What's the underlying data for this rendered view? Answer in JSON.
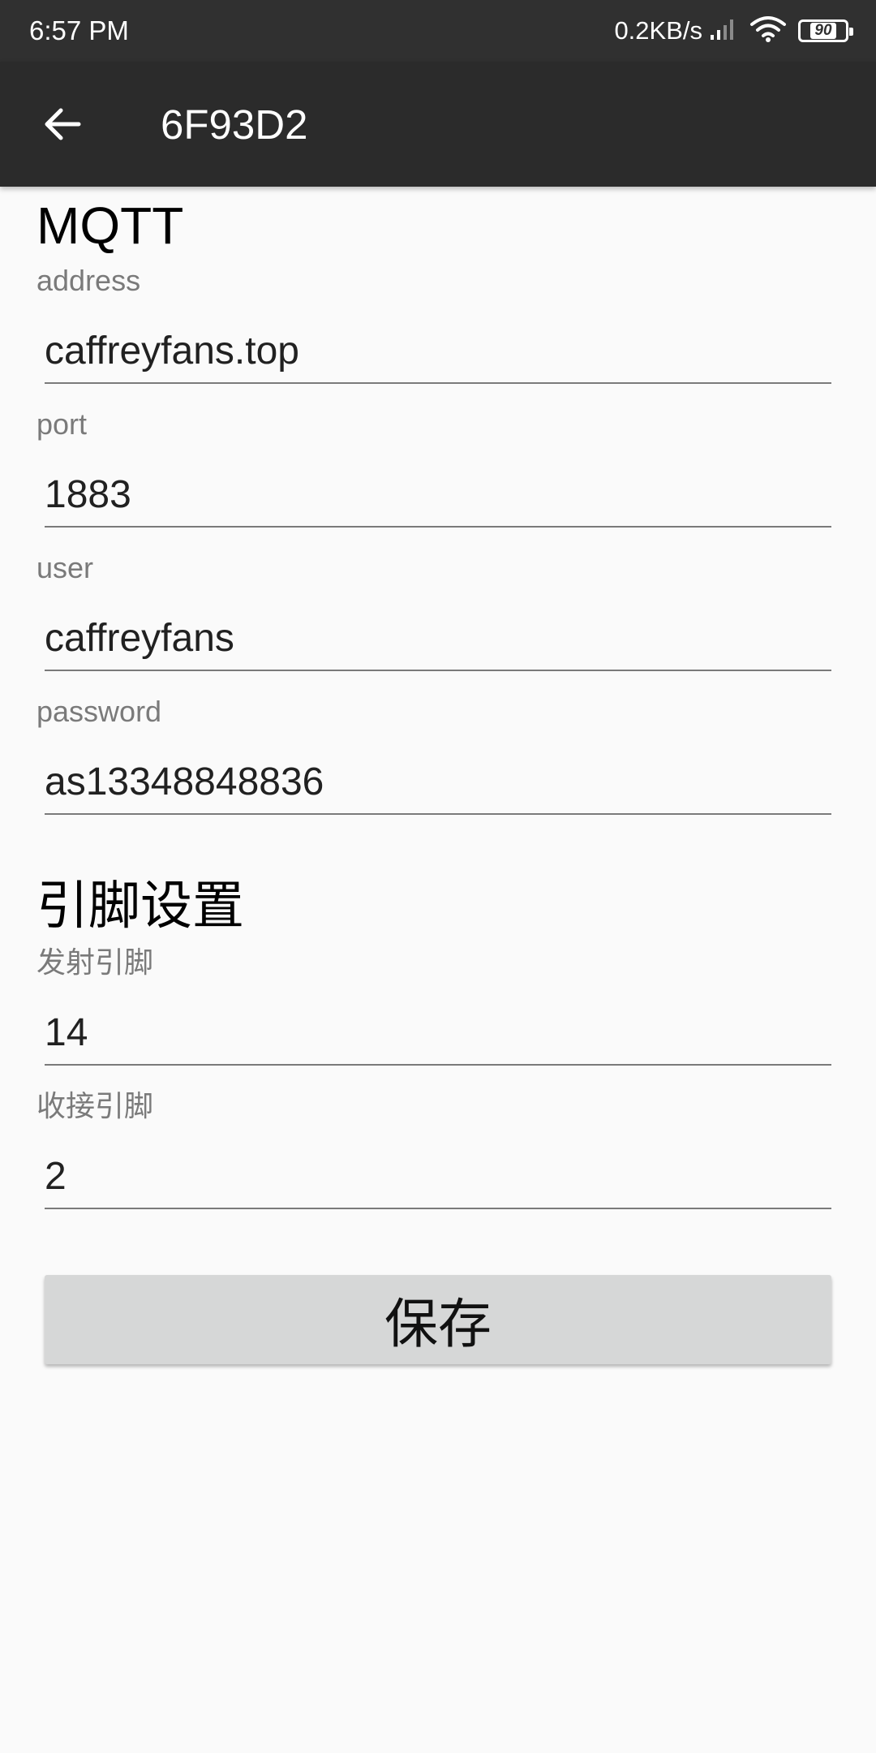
{
  "status_bar": {
    "time": "6:57 PM",
    "net_speed": "0.2KB/s",
    "battery": "90",
    "icons": [
      "signal-icon",
      "wifi-icon",
      "battery-icon"
    ]
  },
  "app_bar": {
    "title": "6F93D2",
    "back_icon": "arrow-back-icon"
  },
  "mqtt": {
    "title": "MQTT",
    "address_label": "address",
    "address_value": "caffreyfans.top",
    "port_label": "port",
    "port_value": "1883",
    "user_label": "user",
    "user_value": "caffreyfans",
    "password_label": "password",
    "password_value": "as13348848836"
  },
  "pins": {
    "title": "引脚设置",
    "tx_label": "发射引脚",
    "tx_value": "14",
    "rx_label": "收接引脚",
    "rx_value": "2"
  },
  "save_label": "保存",
  "colors": {
    "status_bar": "#303030",
    "app_bar": "#2b2b2b",
    "background": "#fafafa",
    "button": "#d6d7d7"
  }
}
